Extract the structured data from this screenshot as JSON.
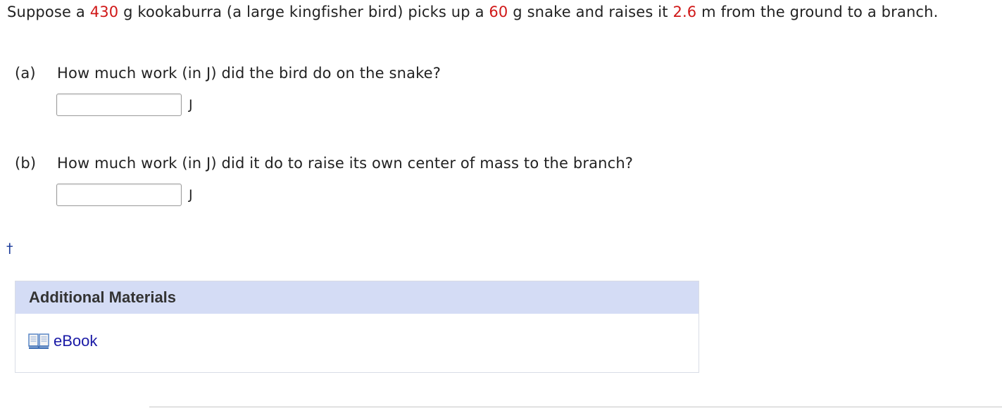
{
  "problem": {
    "segments": [
      {
        "text": "Suppose a ",
        "highlight": false
      },
      {
        "text": "430",
        "highlight": true
      },
      {
        "text": " g kookaburra (a large kingfisher bird) picks up a ",
        "highlight": false
      },
      {
        "text": "60",
        "highlight": true
      },
      {
        "text": " g snake and raises it ",
        "highlight": false
      },
      {
        "text": "2.6",
        "highlight": true
      },
      {
        "text": " m from the ground to a branch.",
        "highlight": false
      }
    ]
  },
  "parts": [
    {
      "label": "(a)",
      "question": "How much work (in J) did the bird do on the snake?",
      "value": "",
      "unit": "J"
    },
    {
      "label": "(b)",
      "question": "How much work (in J) did it do to raise its own center of mass to the branch?",
      "value": "",
      "unit": "J"
    }
  ],
  "footnote_marker": "†",
  "additional_materials": {
    "title": "Additional Materials",
    "links": [
      {
        "label": "eBook",
        "icon": "book-icon"
      }
    ]
  },
  "colors": {
    "highlight": "#d01818",
    "link": "#1a1aa6",
    "materials_header_bg": "#d4dcf5",
    "dagger": "#1a3a9a"
  }
}
